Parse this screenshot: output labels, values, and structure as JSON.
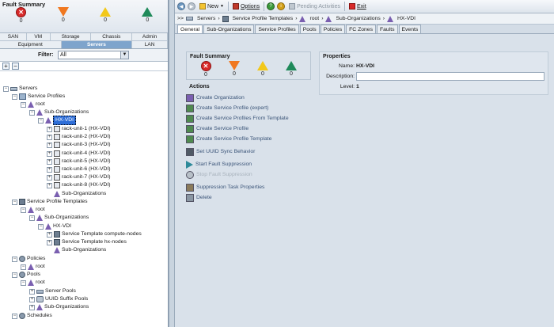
{
  "fault_summary": {
    "title": "Fault Summary",
    "counts": [
      "0",
      "0",
      "0",
      "0"
    ]
  },
  "nav_tabs_top": [
    "SAN",
    "VM",
    "Storage",
    "Chassis",
    "Admin"
  ],
  "nav_tabs_bottom": [
    "Equipment",
    "Servers",
    "LAN"
  ],
  "filter": {
    "label": "Filter:",
    "value": "All"
  },
  "tree": [
    {
      "label": "Servers",
      "depth": 0,
      "type": "srv"
    },
    {
      "label": "Service Profiles",
      "depth": 1,
      "type": "prof"
    },
    {
      "label": "root",
      "depth": 2,
      "type": "org"
    },
    {
      "label": "Sub-Organizations",
      "depth": 3,
      "type": "org"
    },
    {
      "label": "HX-VDI",
      "depth": 4,
      "type": "org",
      "selected": true
    },
    {
      "label": "rack-unit-1 (HX-VDI)",
      "depth": 5,
      "type": "rack"
    },
    {
      "label": "rack-unit-2 (HX-VDI)",
      "depth": 5,
      "type": "rack"
    },
    {
      "label": "rack-unit-3 (HX-VDI)",
      "depth": 5,
      "type": "rack"
    },
    {
      "label": "rack-unit-4 (HX-VDI)",
      "depth": 5,
      "type": "rack"
    },
    {
      "label": "rack-unit-5 (HX-VDI)",
      "depth": 5,
      "type": "rack"
    },
    {
      "label": "rack-unit-6 (HX-VDI)",
      "depth": 5,
      "type": "rack"
    },
    {
      "label": "rack-unit-7 (HX-VDI)",
      "depth": 5,
      "type": "rack"
    },
    {
      "label": "rack-unit-8 (HX-VDI)",
      "depth": 5,
      "type": "rack"
    },
    {
      "label": "Sub-Organizations",
      "depth": 5,
      "type": "org"
    },
    {
      "label": "Service Profile Templates",
      "depth": 1,
      "type": "tmpl"
    },
    {
      "label": "root",
      "depth": 2,
      "type": "org"
    },
    {
      "label": "Sub-Organizations",
      "depth": 3,
      "type": "org"
    },
    {
      "label": "HX-VDI",
      "depth": 4,
      "type": "org"
    },
    {
      "label": "Service Template compute-nodes",
      "depth": 5,
      "type": "tmpl"
    },
    {
      "label": "Service Template hx-nodes",
      "depth": 5,
      "type": "tmpl"
    },
    {
      "label": "Sub-Organizations",
      "depth": 5,
      "type": "org"
    },
    {
      "label": "Policies",
      "depth": 1,
      "type": "pol"
    },
    {
      "label": "root",
      "depth": 2,
      "type": "org"
    },
    {
      "label": "Pools",
      "depth": 1,
      "type": "pol"
    },
    {
      "label": "root",
      "depth": 2,
      "type": "org"
    },
    {
      "label": "Server Pools",
      "depth": 3,
      "type": "srv"
    },
    {
      "label": "UUID Suffix Pools",
      "depth": 3,
      "type": "pool"
    },
    {
      "label": "Sub-Organizations",
      "depth": 3,
      "type": "org"
    },
    {
      "label": "Schedules",
      "depth": 1,
      "type": "pol"
    }
  ],
  "toolbar": {
    "new": "New",
    "options": "Options",
    "pending": "Pending Activities",
    "exit": "Exit"
  },
  "breadcrumb": {
    "prefix": ">>",
    "items": [
      "Servers",
      "Service Profile Templates",
      "root",
      "Sub-Organizations",
      "HX-VDI"
    ]
  },
  "content_tabs": [
    "General",
    "Sub-Organizations",
    "Service Profiles",
    "Pools",
    "Policies",
    "FC Zones",
    "Faults",
    "Events"
  ],
  "fault_panel": {
    "title": "Fault Summary",
    "counts": [
      "0",
      "0",
      "0",
      "0"
    ]
  },
  "actions": {
    "title": "Actions",
    "items": [
      {
        "label": "Create Organization",
        "enabled": true
      },
      {
        "label": "Create Service Profile (expert)",
        "enabled": true
      },
      {
        "label": "Create Service Profiles From Template",
        "enabled": true
      },
      {
        "label": "Create Service Profile",
        "enabled": true
      },
      {
        "label": "Create Service Profile Template",
        "enabled": true
      },
      {
        "label": "Set UUID Sync Behavior",
        "enabled": true
      },
      {
        "label": "Start Fault Suppression",
        "enabled": true
      },
      {
        "label": "Stop Fault Suppression",
        "enabled": false
      },
      {
        "label": "Suppression Task Properties",
        "enabled": true
      },
      {
        "label": "Delete",
        "enabled": true
      }
    ]
  },
  "properties": {
    "title": "Properties",
    "name_label": "Name:",
    "name_value": "HX-VDI",
    "desc_label": "Description:",
    "desc_value": "",
    "level_label": "Level:",
    "level_value": "1"
  }
}
